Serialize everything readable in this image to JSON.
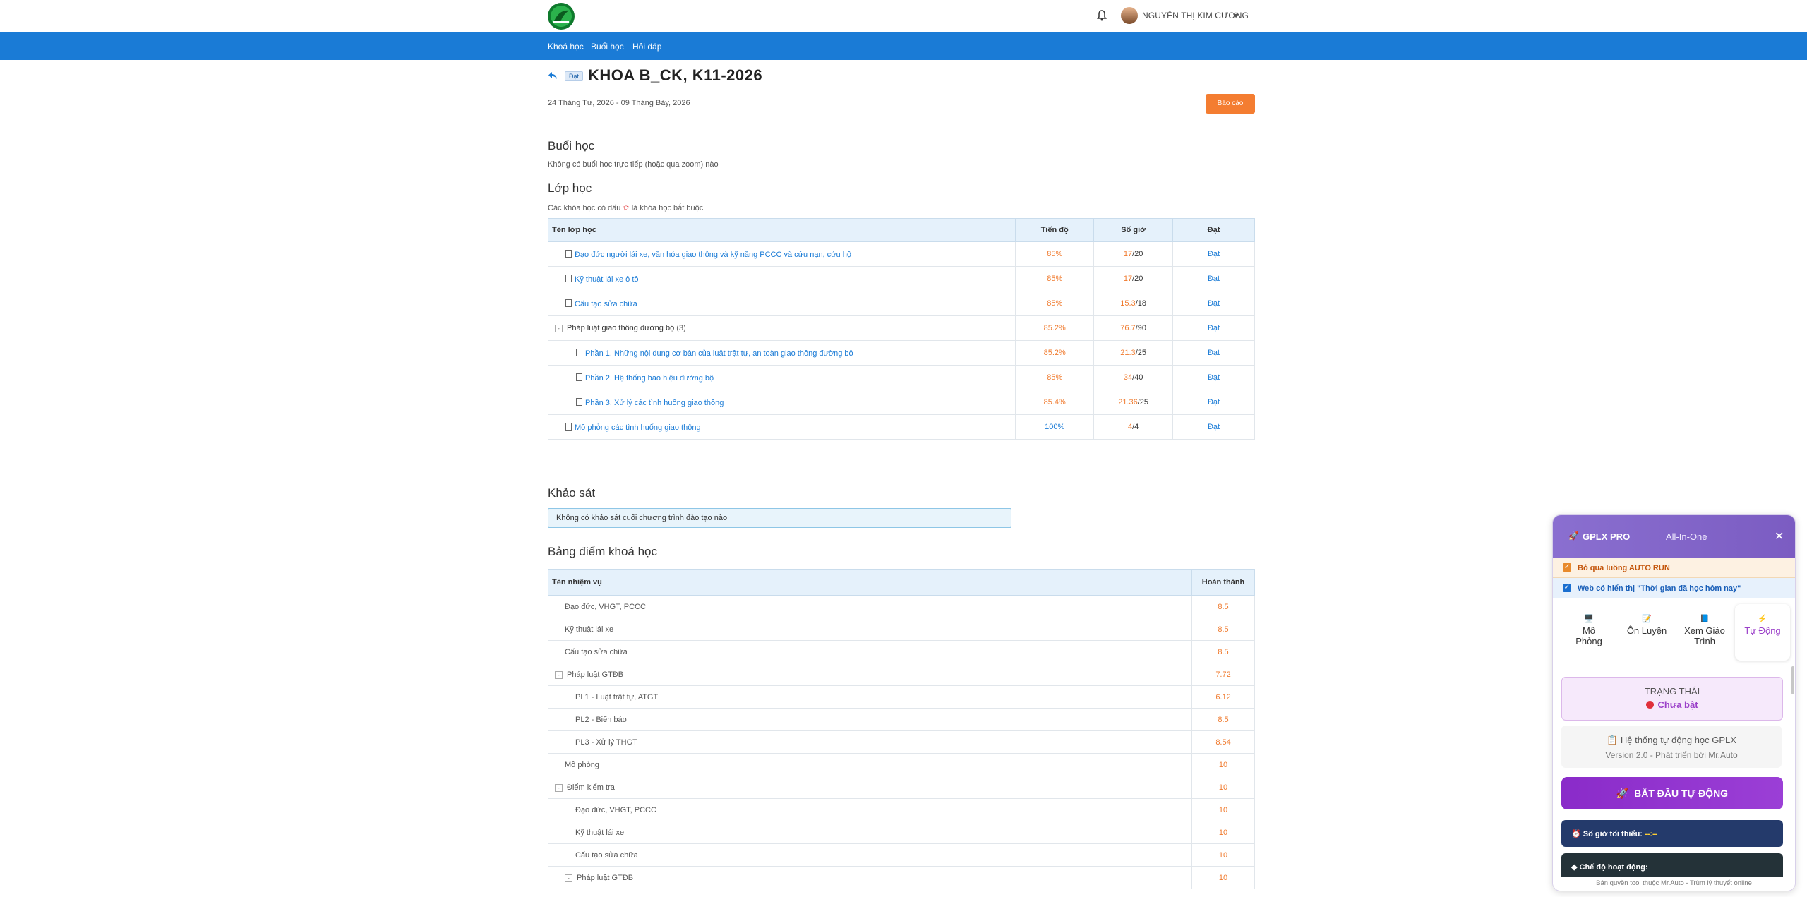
{
  "header": {
    "user_name": "NGUYỄN THỊ KIM CƯƠNG",
    "icons": [
      "logo-icon",
      "bell-icon",
      "avatar",
      "caret-down-icon"
    ]
  },
  "nav": {
    "items": [
      "Khoá học",
      "Buổi học",
      "Hỏi đáp"
    ]
  },
  "course": {
    "status": "Đạt",
    "title": "KHOA B_CK, K11-2026",
    "date_range": "24 Tháng Tư, 2026 - 09 Tháng Bảy, 2026",
    "report_label": "Báo cáo"
  },
  "sessions": {
    "heading": "Buổi học",
    "note": "Không có buổi học trực tiếp (hoặc qua zoom) nào"
  },
  "classes": {
    "heading": "Lớp học",
    "note_before": "Các khóa học có dấu",
    "note_star": "✩",
    "note_after": "là khóa học bắt buộc",
    "columns": [
      "Tên lớp học",
      "Tiến độ",
      "Số giờ",
      "Đạt"
    ],
    "rows": [
      {
        "name": "Đạo đức người lái xe, văn hóa giao thông và kỹ năng PCCC và cứu nạn, cứu hộ",
        "progress": "85%",
        "hours_done": "17",
        "hours_total": "/20",
        "result": "Đạt"
      },
      {
        "name": "Kỹ thuật lái xe ô tô",
        "progress": "85%",
        "hours_done": "17",
        "hours_total": "/20",
        "result": "Đạt"
      },
      {
        "name": "Cấu tạo sửa chữa",
        "progress": "85%",
        "hours_done": "15.3",
        "hours_total": "/18",
        "result": "Đạt"
      },
      {
        "name": "Pháp luật giao thông đường bộ",
        "count": "(3)",
        "progress": "85.2%",
        "hours_done": "76.7",
        "hours_total": "/90",
        "result": "Đạt"
      },
      {
        "name": "Phần 1. Những nội dung cơ bản của luật trật tự, an toàn giao thông đường bộ",
        "progress": "85.2%",
        "hours_done": "21.3",
        "hours_total": "/25",
        "result": "Đạt"
      },
      {
        "name": "Phần 2. Hệ thống báo hiệu đường bộ",
        "progress": "85%",
        "hours_done": "34",
        "hours_total": "/40",
        "result": "Đạt"
      },
      {
        "name": "Phần 3. Xử lý các tình huống giao thông",
        "progress": "85.4%",
        "hours_done": "21.36",
        "hours_total": "/25",
        "result": "Đạt"
      },
      {
        "name": "Mô phỏng các tình huống giao thông",
        "progress": "100%",
        "hours_done": "4",
        "hours_total": "/4",
        "result": "Đạt"
      }
    ]
  },
  "survey": {
    "heading": "Khảo sát",
    "note": "Không có khảo sát cuối chương trình đào tạo nào"
  },
  "grades": {
    "heading": "Bảng điểm khoá học",
    "columns": [
      "Tên nhiệm vụ",
      "Hoàn thành"
    ],
    "rows": [
      {
        "name": "Đạo đức, VHGT, PCCC",
        "score": "8.5"
      },
      {
        "name": "Kỹ thuật lái xe",
        "score": "8.5"
      },
      {
        "name": "Cấu tạo sửa chữa",
        "score": "8.5"
      },
      {
        "name": "Pháp luật GTĐB",
        "score": "7.72"
      },
      {
        "name": "PL1 - Luật trật tự, ATGT",
        "score": "6.12"
      },
      {
        "name": "PL2 - Biển báo",
        "score": "8.5"
      },
      {
        "name": "PL3 - Xử lý THGT",
        "score": "8.54"
      },
      {
        "name": "Mô phỏng",
        "score": "10"
      },
      {
        "name": "Điểm kiểm tra",
        "score": "10"
      },
      {
        "name": "Đạo đức, VHGT, PCCC",
        "score": "10"
      },
      {
        "name": "Kỹ thuật lái xe",
        "score": "10"
      },
      {
        "name": "Cấu tạo sửa chữa",
        "score": "10"
      },
      {
        "name": "Pháp luật GTĐB",
        "score": "10"
      }
    ]
  },
  "panel": {
    "title": "GPLX PRO",
    "subtitle": "All-In-One",
    "close": "✕",
    "option1": "Bỏ qua luồng AUTO RUN",
    "option2": "Web có hiển thị \"Thời gian đã học hôm nay\"",
    "tabs": [
      {
        "icon": "monitor-icon",
        "label1": "Mô",
        "label2": "Phỏng"
      },
      {
        "icon": "memo-icon",
        "label1": "Ôn Luyện",
        "label2": ""
      },
      {
        "icon": "book-icon",
        "label1": "Xem Giáo",
        "label2": "Trình"
      },
      {
        "icon": "bolt-icon",
        "label1": "Tự Động",
        "label2": ""
      }
    ],
    "status_label": "TRẠNG THÁI",
    "status_value": "Chưa bật",
    "info_line1": "Hệ thống tự động học GPLX",
    "info_line2": "Version 2.0 - Phát triển bởi Mr.Auto",
    "start_label": "BẮT ĐẦU TỰ ĐỘNG",
    "min_hours_label": "Số giờ tối thiểu:",
    "min_hours_value": "--:--",
    "mode_label": "Chế độ hoạt động:",
    "footer": "Bản quyền tool thuộc Mr.Auto - Trùm lý thuyết online",
    "colors": {
      "header": "#7b5cc2",
      "accent": "#9b40c9",
      "status_dot": "#e0303b"
    }
  }
}
